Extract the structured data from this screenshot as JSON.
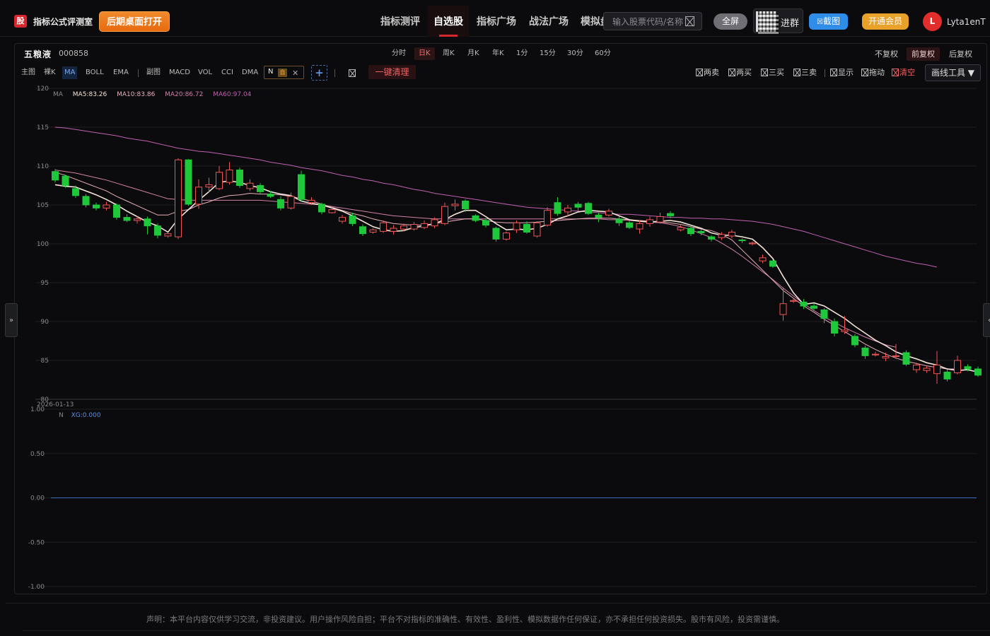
{
  "header": {
    "logo": "股",
    "brand": "指标公式评测室",
    "open_desktop": "后期桌面打开",
    "nav": [
      "指标测评",
      "自选股",
      "指标广场",
      "战法广场",
      "模拟盘"
    ],
    "nav_active": 1,
    "search_placeholder": "输入股票代码/名称",
    "fullscreen": "全屏",
    "group": "进群",
    "screenshot": "截图",
    "vip": "开通会员",
    "avatar_letter": "L",
    "username": "Lyta1enT"
  },
  "stock": {
    "name": "五粮液",
    "code": "000858"
  },
  "periods": [
    "分时",
    "日K",
    "周K",
    "月K",
    "年K",
    "1分",
    "15分",
    "30分",
    "60分"
  ],
  "period_active": 1,
  "adjust": [
    "不复权",
    "前复权",
    "后复权"
  ],
  "adjust_active": 1,
  "toolbar": {
    "main_label": "主图",
    "main_items": [
      "裸K",
      "MA",
      "BOLL",
      "EMA"
    ],
    "main_active": 1,
    "sub_label": "副图",
    "sub_items": [
      "MACD",
      "VOL",
      "CCI",
      "DMA"
    ],
    "n_tag": "N",
    "n_auto": "自",
    "clear_all": "一键清理",
    "checks": [
      "两卖",
      "两买",
      "三买",
      "三卖",
      "显示",
      "拖动",
      "清空"
    ],
    "draw_tools": "画线工具 ▼"
  },
  "colors": {
    "up": "#f05454",
    "down": "#1ec83a",
    "ma5": "#f4e3d7",
    "ma10": "#e8b0b8",
    "ma20": "#d080a8",
    "ma60": "#c060b0",
    "sub_line": "#3a6fbf"
  },
  "legend": {
    "title": "MA",
    "ma5": "MA5:83.26",
    "ma10": "MA10:83.86",
    "ma20": "MA20:86.72",
    "ma60": "MA60:97.04",
    "sub_title": "N",
    "sub_value": "XG:0.000"
  },
  "chart_data": [
    {
      "type": "candlestick",
      "ylim": [
        80,
        120
      ],
      "yticks": [
        80,
        85,
        90,
        95,
        100,
        105,
        110,
        115,
        120
      ],
      "x_label_start": "2026-01-13",
      "candles": [
        [
          109.3,
          108.2,
          109.6,
          107.9
        ],
        [
          108.7,
          107.5,
          108.9,
          107.2
        ],
        [
          107.1,
          106.2,
          107.5,
          105.9
        ],
        [
          106.1,
          105.0,
          106.4,
          104.7
        ],
        [
          105.0,
          104.6,
          105.3,
          104.3
        ],
        [
          104.6,
          105.0,
          105.4,
          104.3
        ],
        [
          105.0,
          103.4,
          105.2,
          103.1
        ],
        [
          103.4,
          103.0,
          103.8,
          102.8
        ],
        [
          103.0,
          103.2,
          103.6,
          102.6
        ],
        [
          103.2,
          102.3,
          103.5,
          101.2
        ],
        [
          102.3,
          101.1,
          102.6,
          100.7
        ],
        [
          101.0,
          101.3,
          101.5,
          100.8
        ],
        [
          100.9,
          110.8,
          111.0,
          100.6
        ],
        [
          110.8,
          105.1,
          110.9,
          104.9
        ],
        [
          105.1,
          107.3,
          108.3,
          104.5
        ],
        [
          107.3,
          107.6,
          108.5,
          106.6
        ],
        [
          107.1,
          109.2,
          110.0,
          106.9
        ],
        [
          107.9,
          109.5,
          110.5,
          107.6
        ],
        [
          109.5,
          107.5,
          109.8,
          107.2
        ],
        [
          107.1,
          107.8,
          108.3,
          106.8
        ],
        [
          107.5,
          106.7,
          107.8,
          106.4
        ],
        [
          106.4,
          106.1,
          106.8,
          105.9
        ],
        [
          105.7,
          104.6,
          106.1,
          104.3
        ],
        [
          104.6,
          106.1,
          106.6,
          104.4
        ],
        [
          108.9,
          105.7,
          109.4,
          105.4
        ],
        [
          105.3,
          105.6,
          106.0,
          105.0
        ],
        [
          105.1,
          104.1,
          105.3,
          103.8
        ],
        [
          104.0,
          104.4,
          104.8,
          103.9
        ],
        [
          102.9,
          103.4,
          103.7,
          102.6
        ],
        [
          103.6,
          102.6,
          104.0,
          102.3
        ],
        [
          102.2,
          101.3,
          102.5,
          101.0
        ],
        [
          101.5,
          101.8,
          102.0,
          101.3
        ],
        [
          101.6,
          102.7,
          103.0,
          101.4
        ],
        [
          101.6,
          102.0,
          102.4,
          101.2
        ],
        [
          101.9,
          102.3,
          102.6,
          101.6
        ],
        [
          101.9,
          102.5,
          102.8,
          101.7
        ],
        [
          102.1,
          102.6,
          103.0,
          101.9
        ],
        [
          102.3,
          103.1,
          103.4,
          102.0
        ],
        [
          102.6,
          104.8,
          105.3,
          102.4
        ],
        [
          104.9,
          105.1,
          105.7,
          104.3
        ],
        [
          105.5,
          104.5,
          105.7,
          104.1
        ],
        [
          103.6,
          103.0,
          103.8,
          102.8
        ],
        [
          103.0,
          102.4,
          103.3,
          102.1
        ],
        [
          102.0,
          100.6,
          102.2,
          100.3
        ],
        [
          100.6,
          101.4,
          101.6,
          100.4
        ],
        [
          101.8,
          102.7,
          103.0,
          101.4
        ],
        [
          102.5,
          101.5,
          102.9,
          101.3
        ],
        [
          101.0,
          102.7,
          102.9,
          100.8
        ],
        [
          102.4,
          104.3,
          104.7,
          102.2
        ],
        [
          105.3,
          103.9,
          106.0,
          103.6
        ],
        [
          104.1,
          104.6,
          105.0,
          103.5
        ],
        [
          105.1,
          104.7,
          105.4,
          104.3
        ],
        [
          105.2,
          103.9,
          105.4,
          103.7
        ],
        [
          103.7,
          103.4,
          104.0,
          102.8
        ],
        [
          103.7,
          104.2,
          104.5,
          103.5
        ],
        [
          103.2,
          102.7,
          103.5,
          102.3
        ],
        [
          102.7,
          102.1,
          102.9,
          101.9
        ],
        [
          101.9,
          102.6,
          103.0,
          101.3
        ],
        [
          102.6,
          103.1,
          103.5,
          102.2
        ],
        [
          102.8,
          103.5,
          104.0,
          102.6
        ],
        [
          103.9,
          103.6,
          104.2,
          103.3
        ],
        [
          101.8,
          102.1,
          102.4,
          101.6
        ],
        [
          102.0,
          101.3,
          102.3,
          101.0
        ],
        [
          101.6,
          101.4,
          101.8,
          101.1
        ],
        [
          100.9,
          100.6,
          101.1,
          100.3
        ],
        [
          100.8,
          101.2,
          101.5,
          100.5
        ],
        [
          101.0,
          101.5,
          101.8,
          100.7
        ],
        [
          100.5,
          100.4,
          100.7,
          100.1
        ],
        [
          100.0,
          100.1,
          100.3,
          99.8
        ],
        [
          97.8,
          98.2,
          98.6,
          97.5
        ],
        [
          97.8,
          97.1,
          98.0,
          96.9
        ],
        [
          90.9,
          92.3,
          94.4,
          90.1
        ],
        [
          92.6,
          92.7,
          93.0,
          92.4
        ],
        [
          92.5,
          92.0,
          92.9,
          91.6
        ],
        [
          92.0,
          91.7,
          92.3,
          91.4
        ],
        [
          91.5,
          90.4,
          91.7,
          89.8
        ],
        [
          90.0,
          88.5,
          90.4,
          88.1
        ],
        [
          88.7,
          88.9,
          90.7,
          88.4
        ],
        [
          88.1,
          87.0,
          88.4,
          86.7
        ],
        [
          86.6,
          85.6,
          86.9,
          85.2
        ],
        [
          85.7,
          85.8,
          86.1,
          85.5
        ],
        [
          85.3,
          85.5,
          86.0,
          84.9
        ],
        [
          85.5,
          85.6,
          87.1,
          85.2
        ],
        [
          86.0,
          84.5,
          86.3,
          84.3
        ],
        [
          83.8,
          84.4,
          84.7,
          83.4
        ],
        [
          83.7,
          84.0,
          84.3,
          83.4
        ],
        [
          83.3,
          84.4,
          86.2,
          82.0
        ],
        [
          83.5,
          82.6,
          83.8,
          82.3
        ],
        [
          83.4,
          85.0,
          85.6,
          83.2
        ],
        [
          84.2,
          83.9,
          84.5,
          83.6
        ],
        [
          83.9,
          83.1,
          84.2,
          82.9
        ]
      ],
      "ma5": [
        107.6,
        107.4,
        107.3,
        106.8,
        106.3,
        105.7,
        105.0,
        104.2,
        103.5,
        102.8,
        102.3,
        101.5,
        103.2,
        104.4,
        105.6,
        106.7,
        107.9,
        108.1,
        107.9,
        107.5,
        107.2,
        106.7,
        106.4,
        106.2,
        105.5,
        105.2,
        105.0,
        104.6,
        104.2,
        103.6,
        102.9,
        102.2,
        101.8,
        101.6,
        101.7,
        102.1,
        102.3,
        102.6,
        103.1,
        103.8,
        104.3,
        104.3,
        103.5,
        102.6,
        101.8,
        101.9,
        101.8,
        102.0,
        102.5,
        103.2,
        103.6,
        104.1,
        104.3,
        104.2,
        104.1,
        103.6,
        103.1,
        102.9,
        102.8,
        102.9,
        103.0,
        102.8,
        102.4,
        102.0,
        101.4,
        101.1,
        101.1,
        100.9,
        100.6,
        99.5,
        98.1,
        95.8,
        93.7,
        92.2,
        92.4,
        92.0,
        91.2,
        90.4,
        89.4,
        88.5,
        87.6,
        86.9,
        86.1,
        85.6,
        85.2,
        84.7,
        84.4,
        83.9,
        83.7,
        83.8,
        83.5
      ],
      "ma10": [
        109.2,
        108.8,
        108.3,
        107.8,
        107.3,
        106.8,
        106.1,
        105.5,
        104.9,
        104.3,
        103.7,
        103.7,
        104.2,
        104.4,
        105.0,
        105.4,
        105.9,
        106.2,
        106.3,
        106.5,
        106.4,
        106.4,
        106.3,
        106.1,
        105.8,
        105.5,
        105.1,
        104.7,
        104.3,
        103.9,
        103.6,
        103.2,
        102.9,
        102.6,
        102.5,
        102.4,
        102.4,
        102.6,
        102.8,
        103.0,
        103.2,
        103.2,
        103.0,
        102.8,
        102.7,
        102.7,
        102.7,
        102.8,
        102.9,
        103.0,
        103.1,
        103.2,
        103.3,
        103.3,
        103.3,
        103.2,
        103.1,
        103.0,
        102.9,
        102.8,
        102.7,
        102.5,
        102.2,
        101.9,
        101.7,
        101.2,
        100.5,
        99.2,
        97.9,
        96.6,
        95.3,
        94.0,
        93.0,
        92.0,
        91.2,
        90.3,
        89.5,
        88.7,
        87.9,
        87.1,
        86.4,
        85.8,
        85.3,
        84.9,
        84.6,
        84.3,
        84.1,
        83.9,
        83.9
      ],
      "ma20": [
        109.5,
        109.3,
        109.1,
        108.8,
        108.5,
        108.2,
        107.8,
        107.4,
        107.0,
        106.6,
        106.2,
        105.8,
        105.7,
        105.6,
        105.6,
        105.6,
        105.6,
        105.6,
        105.6,
        105.6,
        105.6,
        105.5,
        105.4,
        105.3,
        105.2,
        105.1,
        105.0,
        104.8,
        104.6,
        104.4,
        104.2,
        104.0,
        103.8,
        103.6,
        103.5,
        103.4,
        103.3,
        103.2,
        103.2,
        103.2,
        103.2,
        103.2,
        103.2,
        103.2,
        103.2,
        103.2,
        103.2,
        103.2,
        103.2,
        103.2,
        103.2,
        103.2,
        103.2,
        103.2,
        103.1,
        103.1,
        103.0,
        102.9,
        102.8,
        102.7,
        102.5,
        102.2,
        101.8,
        101.3,
        100.8,
        100.1,
        99.3,
        98.4,
        97.4,
        96.4,
        95.4,
        94.3,
        93.3,
        92.3,
        91.4,
        90.6,
        89.9,
        89.2,
        88.6,
        88.0,
        87.5,
        87.0,
        86.7
      ],
      "ma60": [
        115.0,
        114.9,
        114.7,
        114.5,
        114.3,
        114.1,
        113.9,
        113.6,
        113.4,
        113.2,
        112.9,
        112.6,
        112.3,
        112.1,
        111.9,
        111.8,
        111.6,
        111.4,
        111.2,
        111.0,
        110.8,
        110.5,
        110.3,
        110.1,
        109.8,
        109.6,
        109.4,
        109.1,
        108.8,
        108.6,
        108.3,
        108.1,
        107.8,
        107.6,
        107.3,
        107.0,
        106.8,
        106.5,
        106.3,
        106.1,
        105.9,
        105.7,
        105.5,
        105.3,
        105.1,
        104.9,
        104.7,
        104.6,
        104.5,
        104.4,
        104.3,
        104.2,
        104.1,
        104.0,
        103.9,
        103.8,
        103.8,
        103.7,
        103.6,
        103.5,
        103.4,
        103.4,
        103.3,
        103.3,
        103.2,
        103.2,
        103.1,
        103.0,
        102.9,
        102.7,
        102.5,
        102.2,
        101.9,
        101.6,
        101.2,
        100.8,
        100.4,
        100.0,
        99.6,
        99.2,
        98.8,
        98.4,
        98.1,
        97.8,
        97.5,
        97.3,
        97.0
      ]
    },
    {
      "type": "line",
      "title": "N",
      "ylim": [
        -1.0,
        1.0
      ],
      "yticks": [
        "1.00",
        "0.50",
        "0.00",
        "-0.50",
        "-1.00"
      ],
      "series": [
        {
          "name": "XG",
          "value": 0.0
        }
      ]
    }
  ],
  "footer": {
    "disclaimer": "声明：本平台内容仅供学习交流，非投资建议。用户操作风险自担；平台不对指标的准确性、有效性、盈利性、模拟数据作任何保证，亦不承担任何投资损失。股市有风险，投资需谨慎。"
  },
  "sidetabs": {
    "left": "»",
    "right": "«"
  }
}
